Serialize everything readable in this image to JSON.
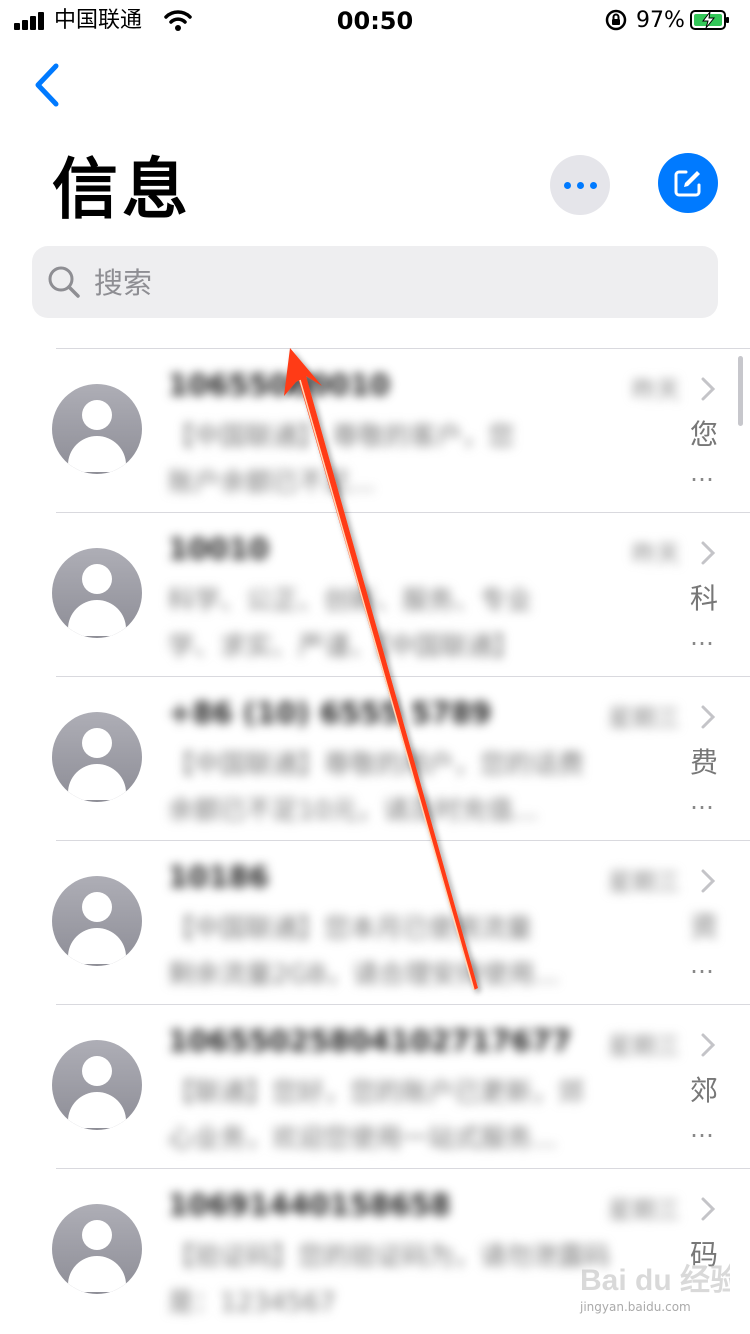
{
  "status_bar": {
    "carrier": "中国联通",
    "time": "00:50",
    "battery_percent": "97%"
  },
  "header": {
    "title": "信息"
  },
  "search": {
    "placeholder": "搜索"
  },
  "conversations": [
    {
      "sender": "10655000010",
      "date": "昨天",
      "preview_line1": "【中国联通】 尊敬的客户，您",
      "preview_line2": "账户余额已不足...",
      "tail_char": "您",
      "ellipsis": "…"
    },
    {
      "sender": "10010",
      "date": "昨天",
      "preview_line1": "科学、公正、创新、服务、专业",
      "preview_line2": "学、求实、严谨、【中国联通】",
      "tail_char": "科",
      "ellipsis": "…"
    },
    {
      "sender": "+86 (10) 6555 5789",
      "date": "星期三",
      "preview_line1": "【中国联通】尊敬的用户，您的话费",
      "preview_line2": "余额已不足10元，请及时充值...",
      "tail_char": "费",
      "ellipsis": "…"
    },
    {
      "sender": "10186",
      "date": "星期三",
      "preview_line1": "【中国联通】您本月已使用流量",
      "preview_line2": "剩余流量2GB，请合理安排使用...",
      "tail_char": "资",
      "ellipsis": "…"
    },
    {
      "sender": "10655025804102717677",
      "date": "星期三",
      "preview_line1": "【联通】您好，您的账户已更新，郊",
      "preview_line2": "心业务，欢迎您使用一站式服务...",
      "tail_char": "郊",
      "ellipsis": "…"
    },
    {
      "sender": "10691440158658",
      "date": "星期三",
      "preview_line1": "【验证码】您的验证码为，请勿泄露码",
      "preview_line2": "是：1234567",
      "tail_char": "码",
      "ellipsis": ""
    }
  ],
  "watermark": {
    "brand": "Bai du 经验",
    "url": "jingyan.baidu.com"
  },
  "colors": {
    "accent": "#007aff",
    "annotation_arrow": "#ff3b12"
  }
}
